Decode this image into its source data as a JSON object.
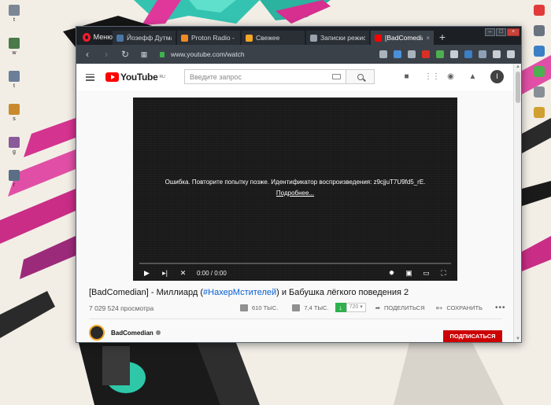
{
  "desktop": {
    "left_icons": [
      {
        "name": "desktop-icon-1",
        "color": "#7b8794",
        "label": "t"
      },
      {
        "name": "desktop-icon-2",
        "color": "#4a7a4a",
        "label": "w"
      },
      {
        "name": "desktop-icon-3",
        "color": "#6b7f99",
        "label": "t"
      },
      {
        "name": "desktop-icon-4",
        "color": "#c98a2e",
        "label": "s"
      },
      {
        "name": "desktop-icon-5",
        "color": "#8a5a9a",
        "label": "g"
      },
      {
        "name": "desktop-icon-6",
        "color": "#5a6f85",
        "label": "r"
      }
    ],
    "right_icons": [
      {
        "name": "tray-icon-opera",
        "color": "#e23a3a"
      },
      {
        "name": "tray-icon-app-1",
        "color": "#6a7480"
      },
      {
        "name": "tray-icon-app-2",
        "color": "#3b7fc4"
      },
      {
        "name": "tray-icon-app-3",
        "color": "#4caf50"
      },
      {
        "name": "tray-icon-app-4",
        "color": "#888e96"
      },
      {
        "name": "tray-icon-app-5",
        "color": "#d0a030"
      }
    ]
  },
  "browser": {
    "menu_label": "Меню",
    "tabs": [
      {
        "label": "Йозефф Дутмас",
        "favicon": "vk-icon",
        "color": "#4a76a8",
        "active": false
      },
      {
        "label": "Proton Radio - St",
        "favicon": "proton-icon",
        "color": "#f08a24",
        "active": false
      },
      {
        "label": "Свежее",
        "favicon": "pikabu-icon",
        "color": "#f5a623",
        "active": false
      },
      {
        "label": "Записки режиссё",
        "favicon": "loading-icon",
        "color": "#9aa3ad",
        "active": false
      },
      {
        "label": "[BadComedian] - М",
        "favicon": "youtube-icon",
        "color": "#ff0000",
        "active": true
      }
    ],
    "new_tab": "+",
    "url": "www.youtube.com/watch",
    "extensions": [
      {
        "name": "camera-icon",
        "color": "#aab2bb"
      },
      {
        "name": "shield-ext-icon",
        "color": "#4a90d9"
      },
      {
        "name": "heart-icon",
        "color": "#aab2bb"
      },
      {
        "name": "abp-icon",
        "color": "#d93025"
      },
      {
        "name": "download-ext-icon",
        "color": "#4caf50"
      },
      {
        "name": "ext-grid-icon",
        "color": "#c9ced4"
      },
      {
        "name": "vpn-icon",
        "color": "#3b7fc4"
      },
      {
        "name": "globe-icon",
        "color": "#8ea0b5"
      },
      {
        "name": "downloads-icon",
        "color": "#c9ced4"
      },
      {
        "name": "menu-lines-icon",
        "color": "#c9ced4"
      }
    ]
  },
  "youtube": {
    "logo_text": "YouTube",
    "region": "RU",
    "search_placeholder": "Введите запрос",
    "avatar_letter": "I",
    "player": {
      "error_text": "Ошибка. Повторите попытку позже. Идентификатор воспроизведения: z9cjjuT7U9fd5_rE.",
      "more_link": "Подробнее...",
      "time": "0:00 / 0:00"
    },
    "video": {
      "title_prefix": "[BadComedian] - Миллиард (",
      "title_tag": "#НахерМстителей",
      "title_suffix": ") и Бабушка лёгкого поведения 2",
      "views": "7 029 524 просмотра",
      "likes": "610 ТЫС.",
      "dislikes": "7,4 ТЫС.",
      "quality": "720",
      "share": "ПОДЕЛИТЬСЯ",
      "save": "СОХРАНИТЬ",
      "more": "•••"
    },
    "channel": {
      "name": "BadComedian",
      "subscribe": "ПОДПИСАТЬСЯ"
    }
  }
}
